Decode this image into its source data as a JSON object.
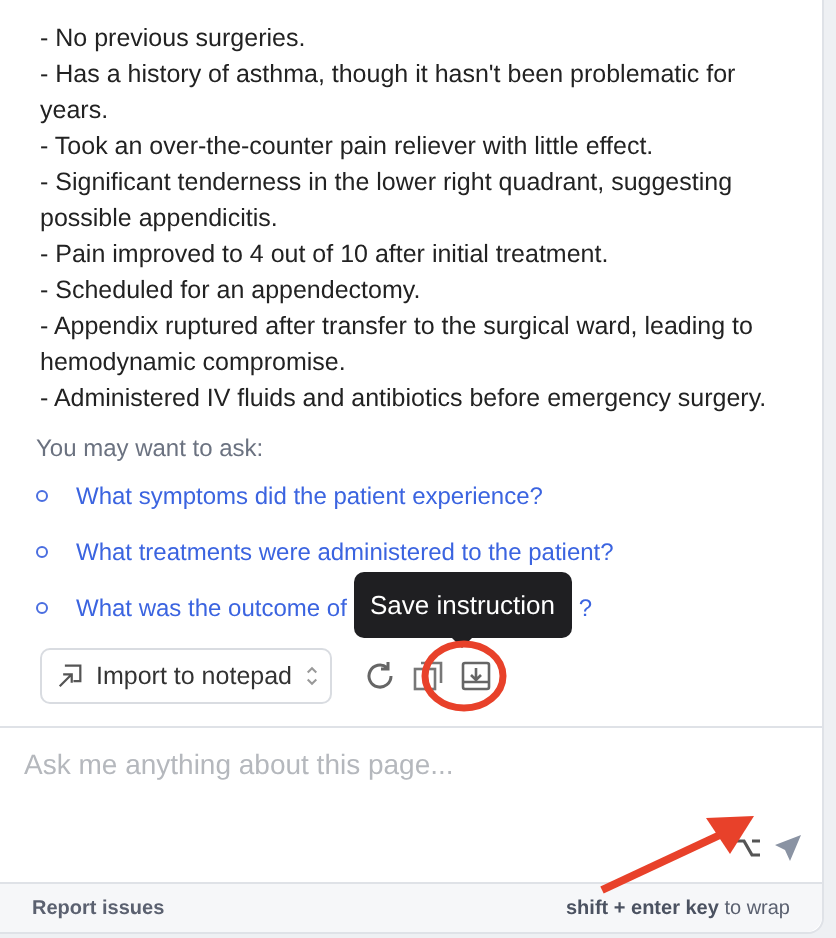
{
  "answer_lines": [
    "- No previous surgeries.",
    "- Has a history of asthma, though it hasn't been problematic for years.",
    "- Took an over-the-counter pain reliever with little effect.",
    "- Significant tenderness in the lower right quadrant, suggesting possible appendicitis.",
    "- Pain improved to 4 out of 10 after initial treatment.",
    "- Scheduled for an appendectomy.",
    "- Appendix ruptured after transfer to the surgical ward, leading to hemodynamic compromise.",
    "- Administered IV fluids and antibiotics before emergency surgery."
  ],
  "suggestions": {
    "heading": "You may want to ask:",
    "items": [
      {
        "text": "What symptoms did the patient experience?"
      },
      {
        "text": "What treatments were administered to the patient?"
      },
      {
        "text": "What was the outcome of",
        "tail": "?"
      }
    ]
  },
  "toolbar": {
    "select": "Import to notepad"
  },
  "tooltip": "Save instruction",
  "input": {
    "placeholder": "Ask me anything about this page..."
  },
  "footer": {
    "link": "Report issues",
    "hint_key": "shift + enter key",
    "hint_text": "to wrap"
  }
}
